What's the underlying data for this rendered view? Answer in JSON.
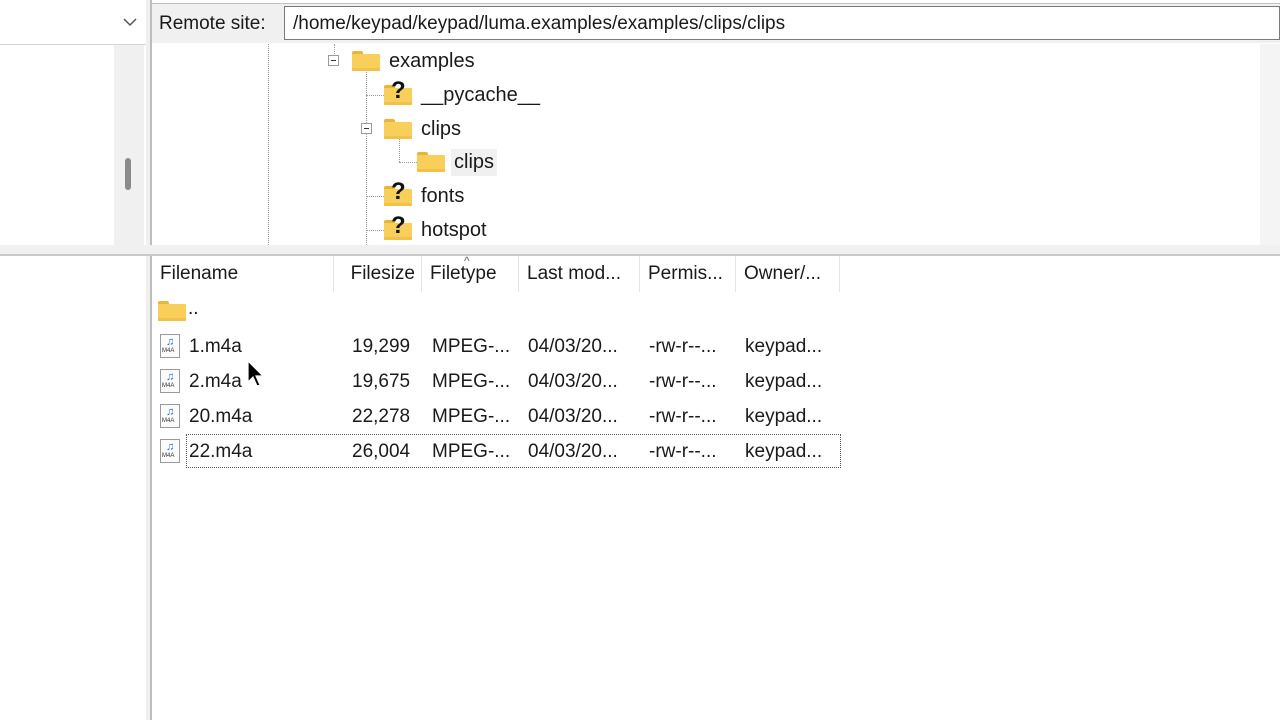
{
  "remote_site": {
    "label": "Remote site:",
    "path": "/home/keypad/keypad/luma.examples/examples/clips/clips"
  },
  "tree": {
    "nodes": [
      {
        "label": "examples",
        "icon": "folder-icon",
        "expanded": true
      },
      {
        "label": "__pycache__",
        "icon": "unknown-folder-icon"
      },
      {
        "label": "clips",
        "icon": "folder-icon",
        "expanded": true
      },
      {
        "label": "clips",
        "icon": "folder-icon",
        "selected": true
      },
      {
        "label": "fonts",
        "icon": "unknown-folder-icon"
      },
      {
        "label": "hotspot",
        "icon": "unknown-folder-icon"
      }
    ]
  },
  "file_list": {
    "columns": [
      "Filename",
      "Filesize",
      "Filetype",
      "Last mod...",
      "Permis...",
      "Owner/..."
    ],
    "parent_dir": "..",
    "rows": [
      {
        "name": "1.m4a",
        "size": "19,299",
        "type": "MPEG-...",
        "modified": "04/03/20...",
        "perms": "-rw-r--...",
        "owner": "keypad..."
      },
      {
        "name": "2.m4a",
        "size": "19,675",
        "type": "MPEG-...",
        "modified": "04/03/20...",
        "perms": "-rw-r--...",
        "owner": "keypad..."
      },
      {
        "name": "20.m4a",
        "size": "22,278",
        "type": "MPEG-...",
        "modified": "04/03/20...",
        "perms": "-rw-r--...",
        "owner": "keypad..."
      },
      {
        "name": "22.m4a",
        "size": "26,004",
        "type": "MPEG-...",
        "modified": "04/03/20...",
        "perms": "-rw-r--...",
        "owner": "keypad..."
      }
    ],
    "icon_tag": "M4A"
  },
  "colors": {
    "folder": "#f9cf5c",
    "pane_bg": "#f0f0f0",
    "audio_note": "#2a6fb8"
  }
}
